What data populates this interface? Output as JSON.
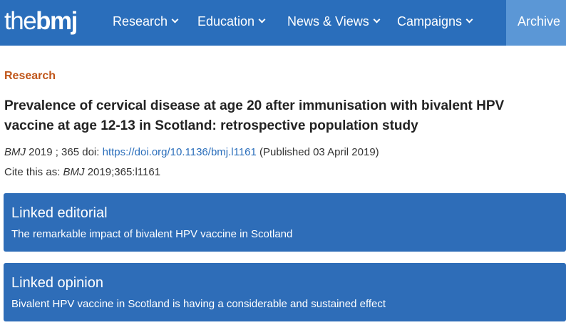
{
  "header": {
    "logo_light": "the",
    "logo_bold": "bmj",
    "nav": [
      {
        "label": "Research"
      },
      {
        "label": "Education"
      },
      {
        "label": "News & Views"
      },
      {
        "label": "Campaigns"
      }
    ],
    "archive_label": "Archive",
    "colors": {
      "bar": "#2a6ebb",
      "archive_tab": "#5b97d6"
    }
  },
  "article": {
    "section": "Research",
    "section_color": "#c0561a",
    "title": "Prevalence of cervical disease at age 20 after immunisation with bivalent HPV vaccine at age 12-13 in Scotland: retrospective population study",
    "meta": {
      "journal": "BMJ",
      "year_volume": "2019 ; 365",
      "doi_label": "doi:",
      "doi_link": "https://doi.org/10.1136/bmj.l1161",
      "published": "(Published 03 April 2019)"
    },
    "cite": {
      "prefix": "Cite this as:",
      "journal": "BMJ",
      "reference": "2019;365:l1161"
    }
  },
  "linked": [
    {
      "heading": "Linked editorial",
      "text": "The remarkable impact of bivalent HPV vaccine in Scotland"
    },
    {
      "heading": "Linked opinion",
      "text": "Bivalent HPV vaccine in Scotland is having a considerable and sustained effect"
    }
  ]
}
